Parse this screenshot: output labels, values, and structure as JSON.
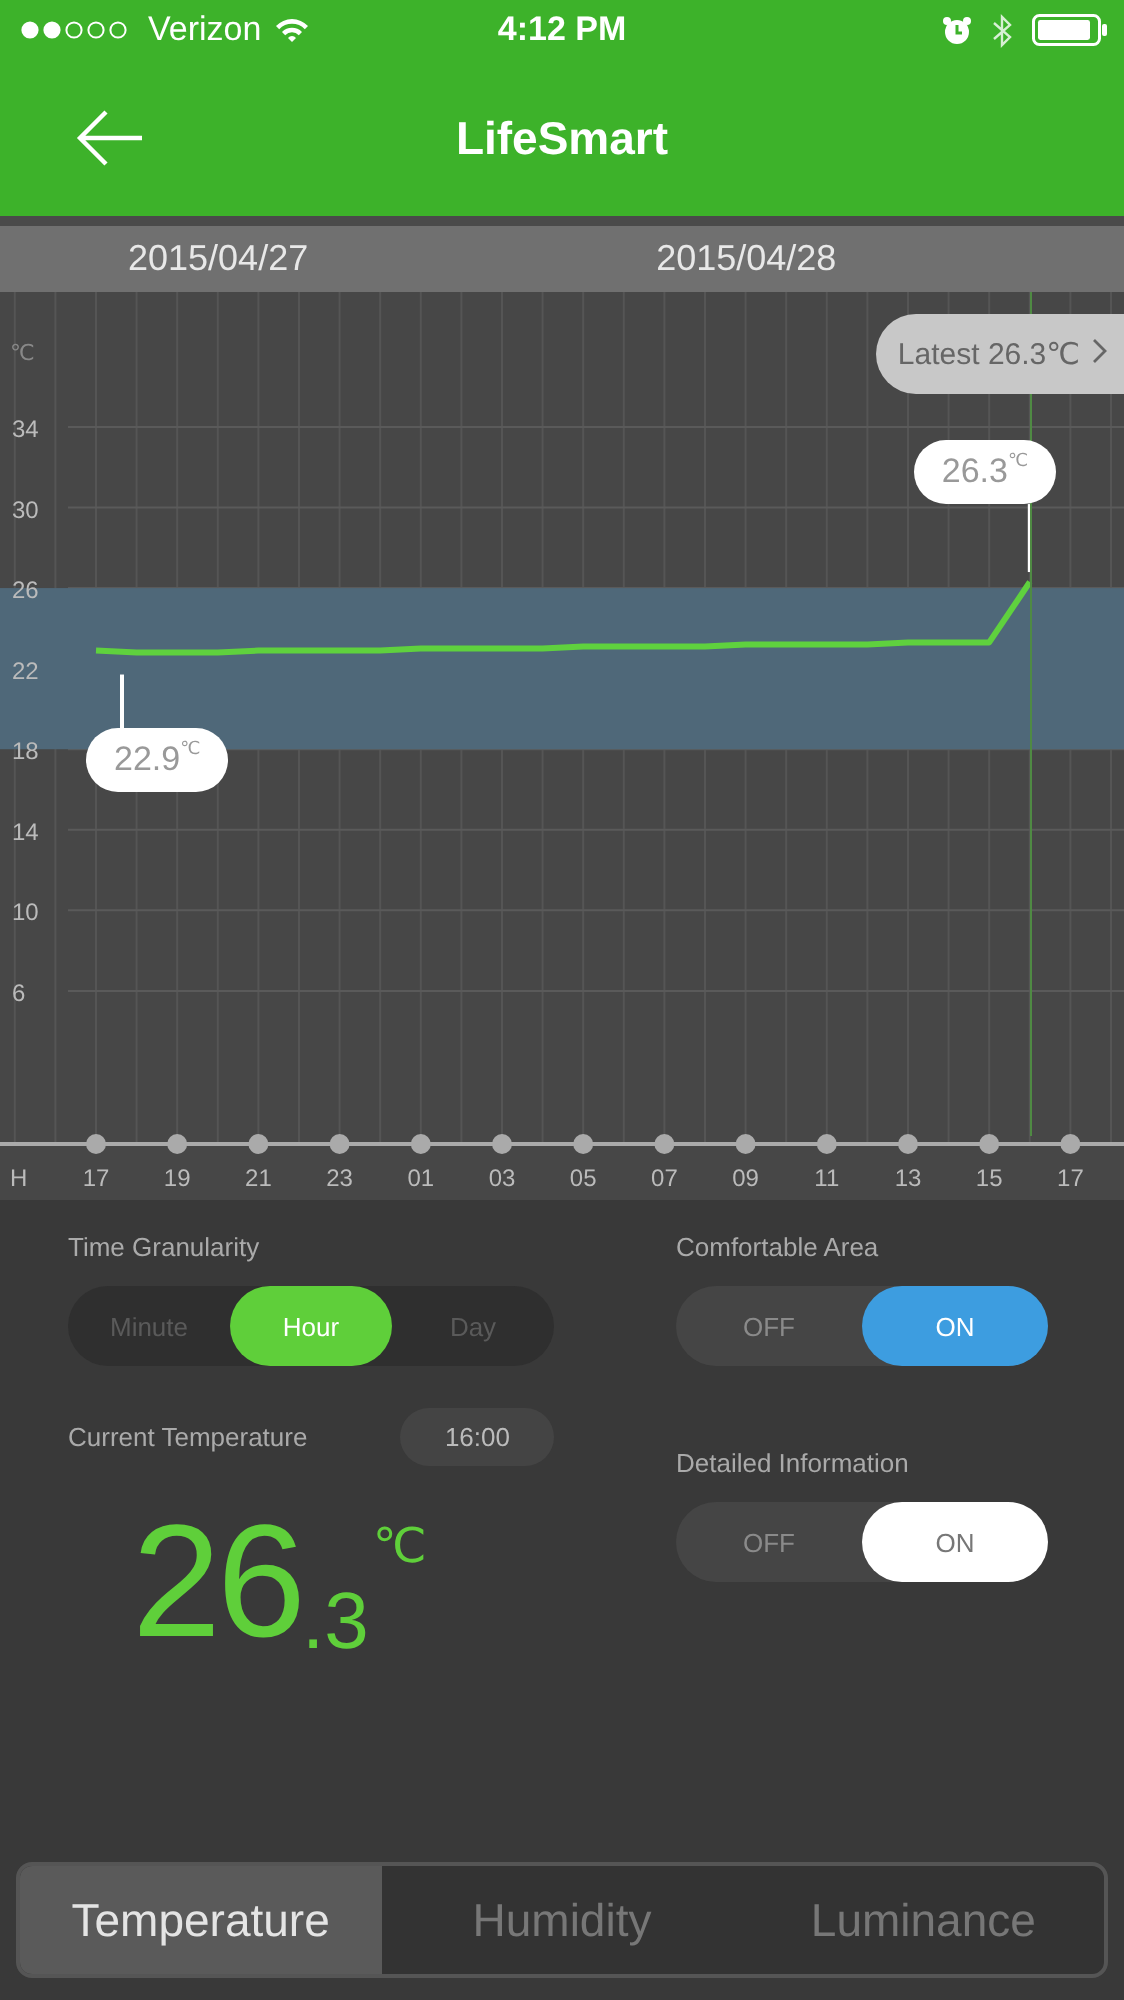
{
  "status_bar": {
    "carrier": "Verizon",
    "time": "4:12 PM"
  },
  "header": {
    "title": "LifeSmart"
  },
  "date_bar": {
    "dates": [
      "2015/04/27",
      "2015/04/28"
    ]
  },
  "chart": {
    "latest_button": "Latest 26.3℃",
    "callouts": [
      {
        "text": "22.9$^{℃}$"
      },
      {
        "text": "26.3$^{℃}$"
      }
    ],
    "chart_data": {
      "type": "line",
      "ylabel": "℃",
      "xlabel": "H",
      "categories": [
        "17",
        null,
        "19",
        null,
        "21",
        null,
        "23",
        null,
        "01",
        null,
        "03",
        null,
        "05",
        null,
        "07",
        null,
        "09",
        null,
        "11",
        null,
        "13",
        null,
        "15",
        null,
        "17"
      ],
      "series": [
        {
          "color": "#5fd13e",
          "values": [
            22.9,
            22.8,
            22.8,
            22.8,
            22.9,
            22.9,
            22.9,
            22.9,
            23.0,
            23.0,
            23.0,
            23.0,
            23.1,
            23.1,
            23.1,
            23.1,
            23.2,
            23.2,
            23.2,
            23.2,
            23.3,
            23.3,
            23.3,
            26.3,
            null
          ]
        }
      ],
      "ylim": [
        -1.6,
        40.7
      ],
      "yticks": [
        6,
        10,
        14,
        18,
        22,
        26,
        30,
        34
      ],
      "grid": true,
      "bands": [
        {
          "axis": "y",
          "from": 18,
          "to": 26,
          "color": "#4f6879"
        }
      ]
    }
  },
  "controls": {
    "granularity": {
      "label": "Time Granularity",
      "options": [
        {
          "label": "Minute",
          "selected": false
        },
        {
          "label": "Hour",
          "selected": true
        },
        {
          "label": "Day",
          "selected": false
        }
      ]
    },
    "comfortable_area": {
      "label": "Comfortable Area",
      "kind": "accent",
      "off": "OFF",
      "on_label": "ON",
      "on": true
    },
    "current_temperature": {
      "label": "Current Temperature",
      "time": "16:00",
      "whole": "26",
      "fraction": ".3",
      "unit": "℃"
    },
    "detailed_information": {
      "label": "Detailed Information",
      "kind": "plain",
      "off": "OFF",
      "on_label": "ON",
      "on": true
    }
  },
  "tabs": [
    {
      "label": "Temperature",
      "selected": true
    },
    {
      "label": "Humidity",
      "selected": false
    },
    {
      "label": "Luminance",
      "selected": false
    }
  ]
}
